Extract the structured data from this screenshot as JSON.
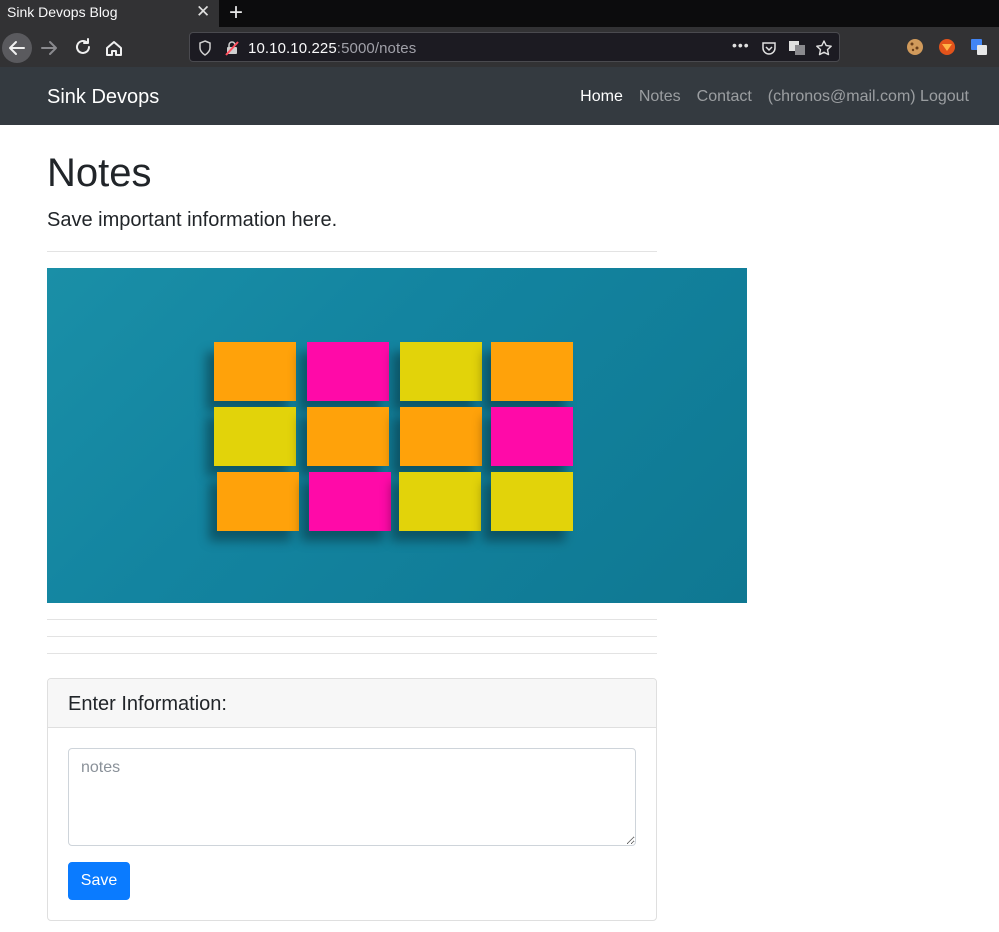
{
  "browser": {
    "tab_title": "Sink Devops Blog",
    "tab_close": "✕",
    "new_tab": "+",
    "url_host": "10.10.10.225",
    "url_path": ":5000/notes",
    "page_actions": "•••"
  },
  "site": {
    "brand": "Sink Devops",
    "nav": [
      {
        "label": "Home",
        "active": true
      },
      {
        "label": "Notes",
        "active": false
      },
      {
        "label": "Contact",
        "active": false
      },
      {
        "label": "(chronos@mail.com) Logout",
        "active": false
      }
    ]
  },
  "page": {
    "title": "Notes",
    "lead": "Save important information here."
  },
  "form": {
    "card_title": "Enter Information:",
    "placeholder": "notes",
    "value": "",
    "save_label": "Save"
  },
  "colors": {
    "navbar_bg": "#343a40",
    "button_primary": "#0a7bff",
    "hero_bg": "#1384a0",
    "note_orange": "#ffa20a",
    "note_pink": "#ff0aa8",
    "note_yellow": "#e2d30a"
  }
}
